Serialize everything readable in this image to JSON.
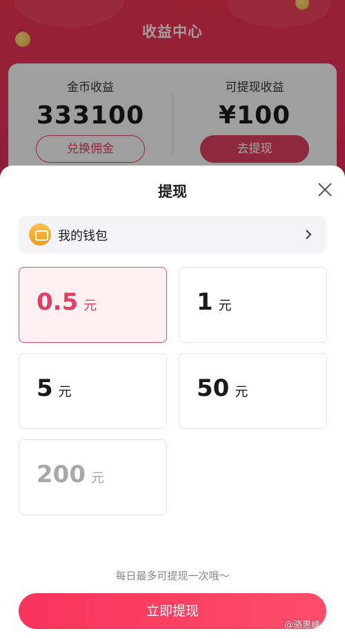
{
  "header": {
    "title": "收益中心"
  },
  "earnings": {
    "coin_label": "金币收益",
    "coin_value": "333100",
    "exchange_button": "兑换佣金",
    "withdrawable_label": "可提现收益",
    "withdrawable_value": "¥100",
    "withdraw_button": "去提现"
  },
  "sheet": {
    "title": "提现",
    "close_icon": "close-icon",
    "wallet": {
      "icon": "wallet-icon",
      "label": "我的钱包",
      "chevron": "chevron-right-icon"
    },
    "amounts": [
      {
        "value": "0.5",
        "unit": "元",
        "state": "selected"
      },
      {
        "value": "1",
        "unit": "元",
        "state": "normal"
      },
      {
        "value": "5",
        "unit": "元",
        "state": "normal"
      },
      {
        "value": "50",
        "unit": "元",
        "state": "normal"
      },
      {
        "value": "200",
        "unit": "元",
        "state": "disabled"
      }
    ],
    "note": "每日最多可提现一次哦～",
    "submit_button": "立即提现"
  },
  "watermark": "@骆惠峰",
  "colors": {
    "accent": "#e03f62",
    "header_red": "#e8334f",
    "selected_bg": "#fff0f3",
    "cta_start": "#f8335c",
    "cta_end": "#ff4d6a"
  }
}
